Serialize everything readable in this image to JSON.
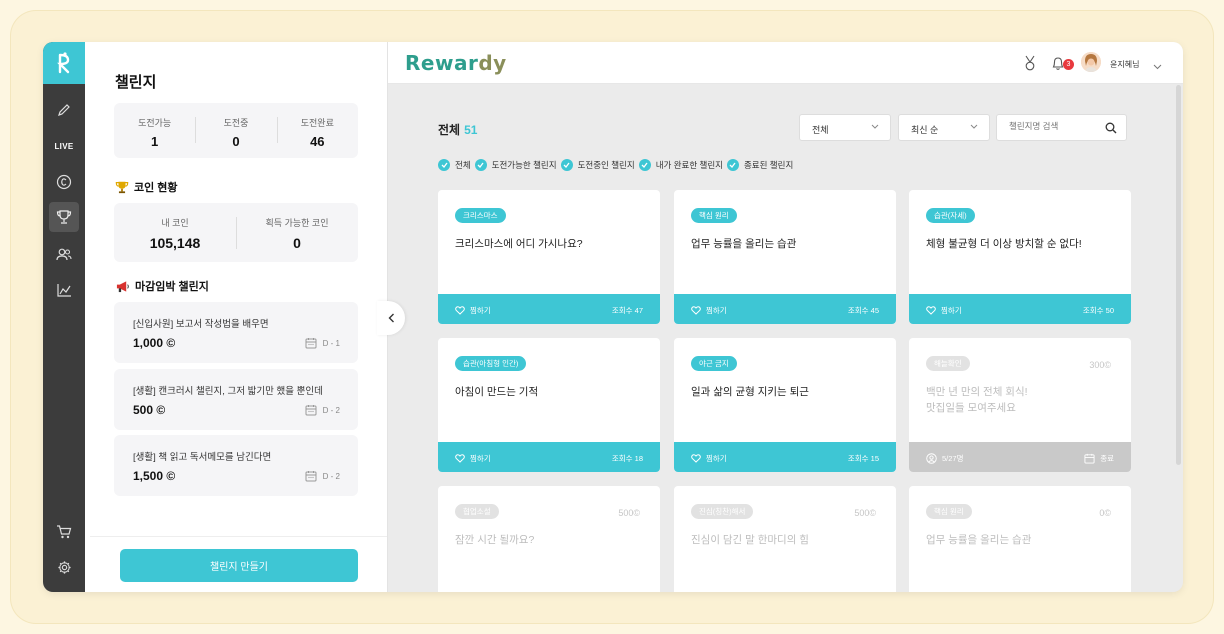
{
  "brand": {
    "name_prefix": "Rewar",
    "name_suffix": "dy",
    "accent": "#3ec6d4"
  },
  "rail": {
    "live_label": "LIVE"
  },
  "panel": {
    "title": "챌린지",
    "stats": [
      {
        "label": "도전가능",
        "value": "1"
      },
      {
        "label": "도전중",
        "value": "0"
      },
      {
        "label": "도전완료",
        "value": "46"
      }
    ],
    "coin_title": "코인 현황",
    "coins": [
      {
        "label": "내 코인",
        "value": "105,148"
      },
      {
        "label": "획득 가능한 코인",
        "value": "0"
      }
    ],
    "deadline_title": "마감임박 챌린지",
    "deadline": [
      {
        "title": "[신입사원] 보고서 작성법을 배우면",
        "coin": "1,000",
        "day": "D - 1"
      },
      {
        "title": "[생활] 캔크러시 챌린지, 그저 밟기만 했을 뿐인데",
        "coin": "500",
        "day": "D - 2"
      },
      {
        "title": "[생활] 책 읽고 독서메모를 남긴다면",
        "coin": "1,500",
        "day": "D - 2"
      }
    ],
    "create_button": "챌린지 만들기"
  },
  "header": {
    "notification_count": "3",
    "username": "윤지혜님"
  },
  "main": {
    "title": "전체",
    "count": "51",
    "select_category": "전체",
    "select_sort": "최신 순",
    "search_placeholder": "챌린지명 검색",
    "filters": [
      "전체",
      "도전가능한 챌린지",
      "도전중인 챌린지",
      "내가 완료한 챌린지",
      "종료된 챌린지"
    ],
    "like_label": "찜하기",
    "cards": [
      {
        "tag": "크리스마스",
        "title": "크리스마스에 어디 가시나요?",
        "views": "조회수 47"
      },
      {
        "tag": "핵심 원리",
        "title": "업무 능률을 올리는 습관",
        "views": "조회수 45"
      },
      {
        "tag": "습관(자세)",
        "title": "체형 불균형 더 이상 방치할 순 없다!",
        "views": "조회수 50"
      },
      {
        "tag": "습관(아침형 인간)",
        "title": "아침이 만드는 기적",
        "views": "조회수 18"
      },
      {
        "tag": "야근 금지",
        "title": "일과 삶의 균형 지키는 퇴근",
        "views": "조회수 15"
      },
      {
        "tag": "해늘확인",
        "title": "백만 년 만의 전체 회식!\n맛집일들 모여주세요",
        "coin": "300",
        "members": "5/27명",
        "status": "종료"
      },
      {
        "tag": "협업소설",
        "title": "잠깐 시간 될까요?",
        "coin": "500"
      },
      {
        "tag": "진심(칭찬)해서",
        "title": "진심이 담긴 말 한마디의 힘",
        "coin": "500"
      },
      {
        "tag": "핵심 원리",
        "title": "업무 능률을 올리는 습관",
        "coin": "0"
      }
    ]
  }
}
